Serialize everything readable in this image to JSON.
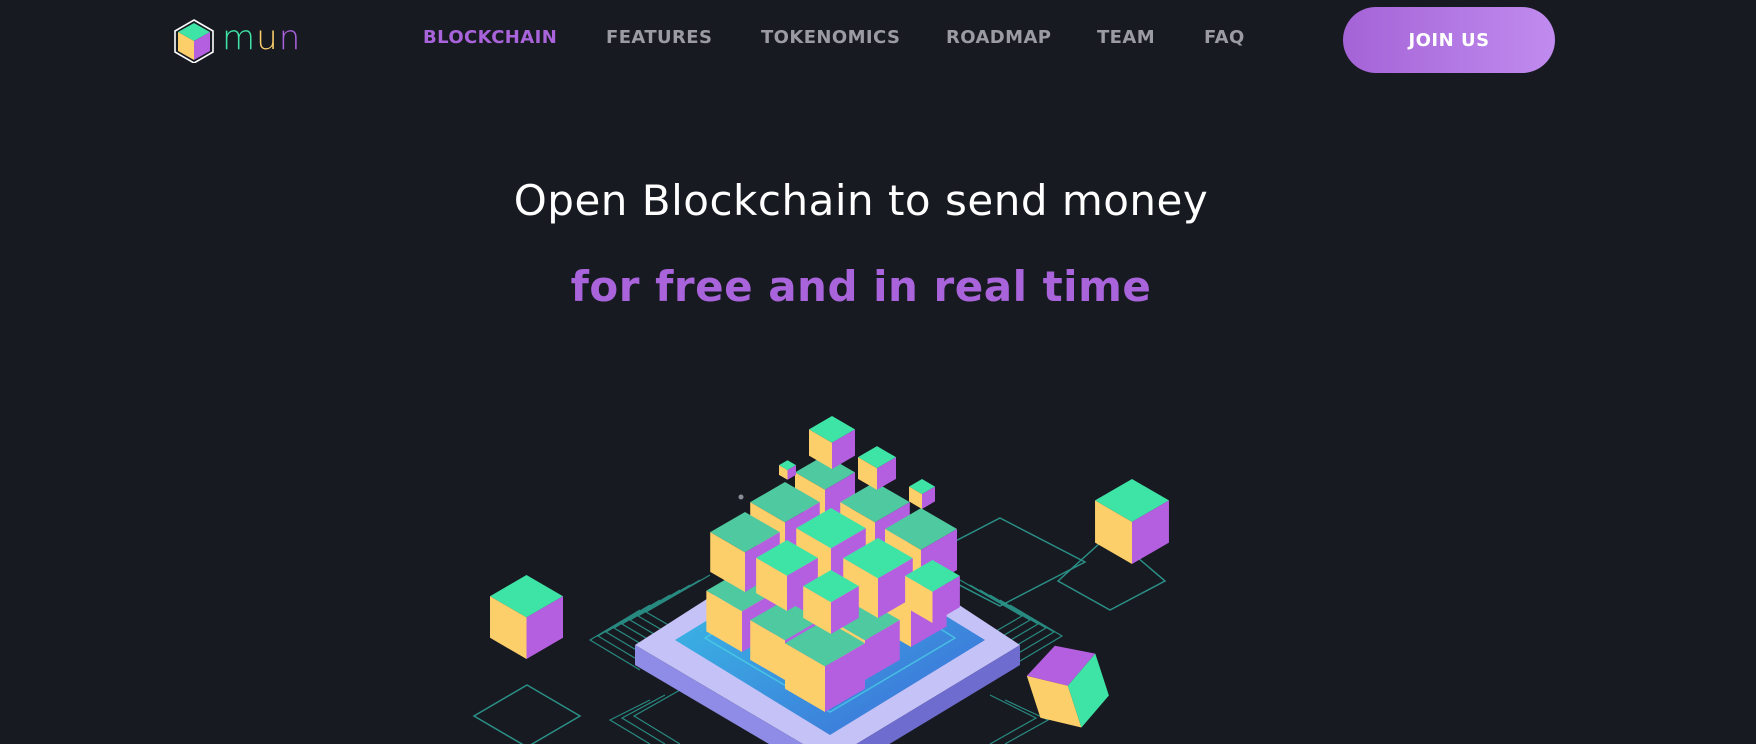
{
  "header": {
    "logo_text": [
      "m",
      "u",
      "n"
    ],
    "nav": [
      {
        "label": "BLOCKCHAIN",
        "active": true
      },
      {
        "label": "FEATURES",
        "active": false
      },
      {
        "label": "TOKENOMICS",
        "active": false
      },
      {
        "label": "ROADMAP",
        "active": false
      },
      {
        "label": "TEAM",
        "active": false
      },
      {
        "label": "FAQ",
        "active": false
      }
    ],
    "cta_label": "JOIN US"
  },
  "hero": {
    "title": "Open Blockchain to send money",
    "subtitle": "for free and in real time"
  },
  "colors": {
    "background": "#181a21",
    "accent": "#a964db",
    "cube_top": "#3ee4a6",
    "cube_left": "#fccf6b",
    "cube_right": "#b45fe0",
    "platform": "#c4c2f6"
  },
  "icons": {
    "logo": "mun-cube-logo-icon",
    "illustration": "isometric-blockchain-cubes-illustration"
  }
}
